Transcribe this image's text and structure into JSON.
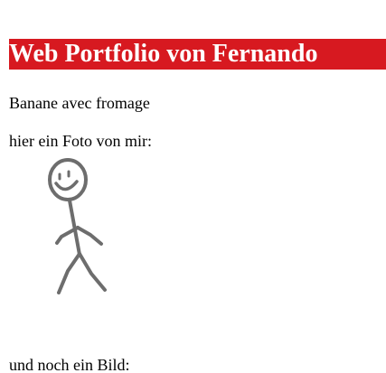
{
  "page": {
    "heading": "Web Portfolio von Fernando",
    "intro_text": "Banane avec fromage",
    "photo_caption": "hier ein Foto von mir:",
    "second_caption": "und noch ein Bild:"
  },
  "colors": {
    "header_background": "#d71920",
    "header_text": "#ffffff",
    "body_text": "#000000",
    "sketch_stroke": "#6d6d6d"
  },
  "image": {
    "semantic": "stick-figure-drawing"
  }
}
